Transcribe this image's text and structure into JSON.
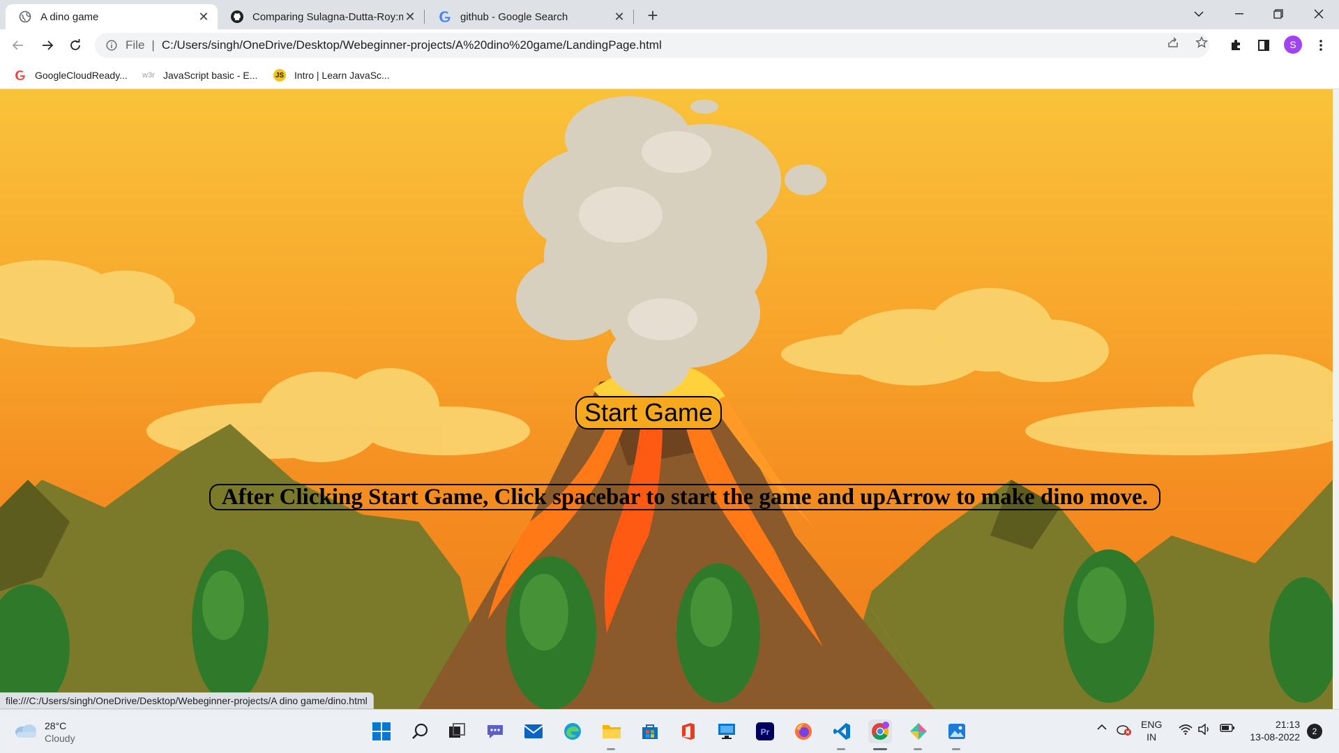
{
  "browser": {
    "tabs": [
      {
        "title": "A dino game",
        "active": true
      },
      {
        "title": "Comparing Sulagna-Dutta-Roy:m",
        "active": false
      },
      {
        "title": "github - Google Search",
        "active": false
      }
    ],
    "omnibox": {
      "scheme": "File",
      "url": "C:/Users/singh/OneDrive/Desktop/Webeginner-projects/A%20dino%20game/LandingPage.html"
    },
    "profile_initial": "S",
    "bookmarks": [
      {
        "label": "GoogleCloudReady...",
        "icon": "google-icon"
      },
      {
        "label": "JavaScript basic - E...",
        "icon": "w3r-icon",
        "icon_text": "w3r"
      },
      {
        "label": "Intro | Learn JavaSc...",
        "icon": "js-icon",
        "icon_text": "JS"
      }
    ],
    "status_url": "file:///C:/Users/singh/OneDrive/Desktop/Webeginner-projects/A dino game/dino.html"
  },
  "page": {
    "start_button_label": "Start Game",
    "instructions": "After Clicking Start Game, Click spacebar to start the game and upArrow to make dino move."
  },
  "taskbar": {
    "weather": {
      "temp": "28°C",
      "condition": "Cloudy"
    },
    "language": {
      "line1": "ENG",
      "line2": "IN"
    },
    "clock": {
      "time": "21:13",
      "date": "13-08-2022"
    },
    "notification_count": "2",
    "apps": [
      "windows-start-icon",
      "search-icon",
      "task-view-icon",
      "teams-chat-icon",
      "mail-icon",
      "edge-icon",
      "file-explorer-icon",
      "microsoft-store-icon",
      "office-icon",
      "desktop-app-icon",
      "premiere-pro-icon",
      "firefox-icon",
      "vscode-icon",
      "chrome-icon",
      "git-kraken-icon",
      "photos-icon"
    ]
  },
  "colors": {
    "accent_profile": "#a142f4",
    "sky_top": "#f9c33a",
    "sky_bottom": "#f07a18"
  }
}
